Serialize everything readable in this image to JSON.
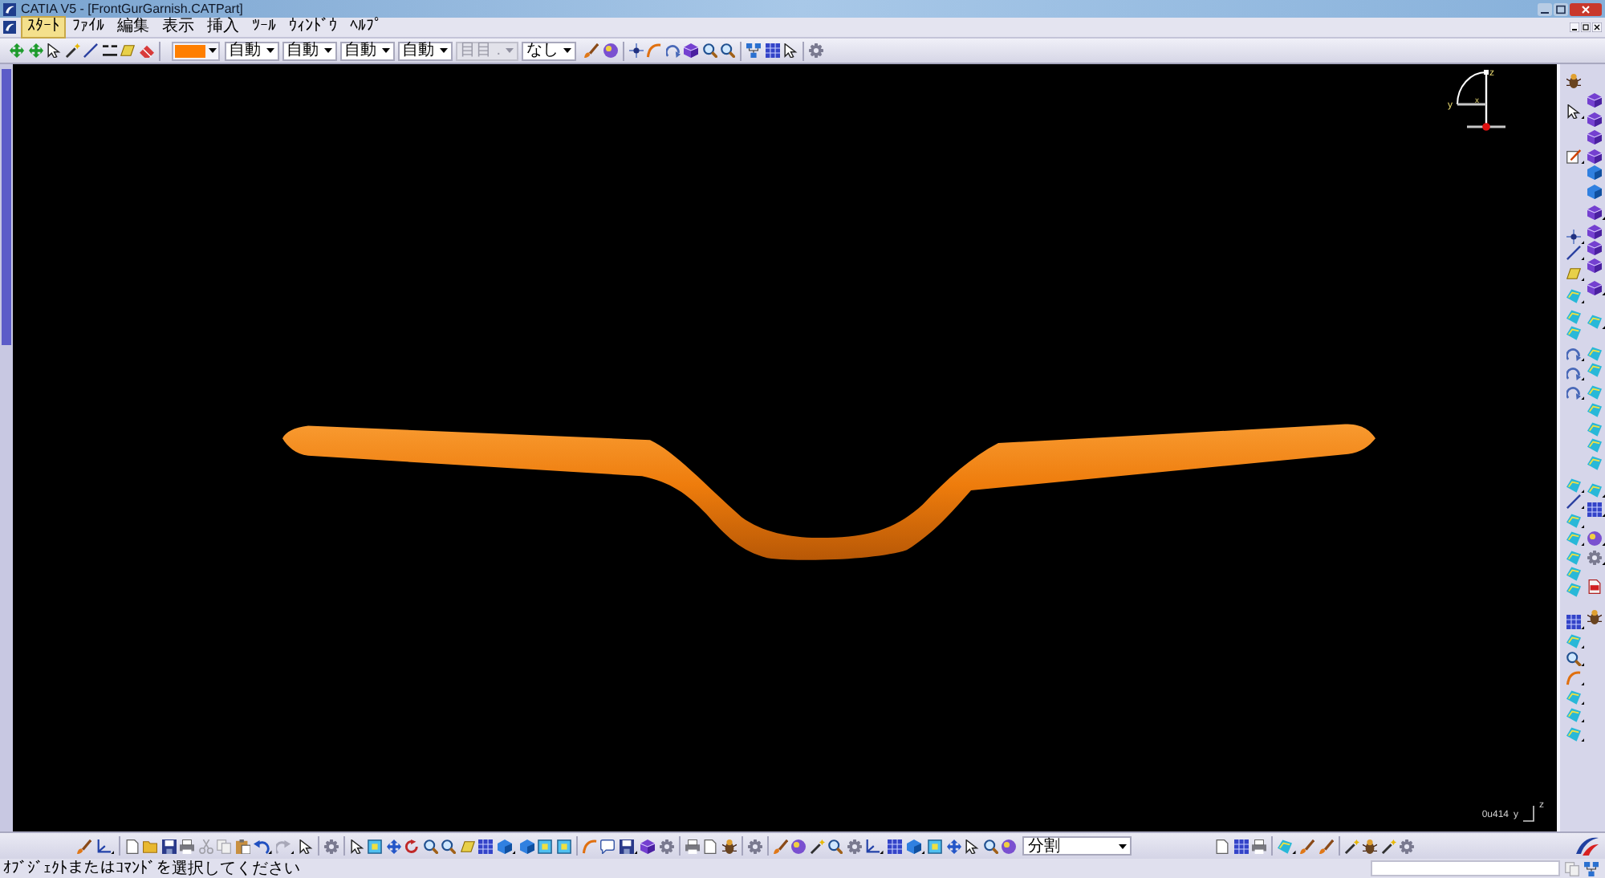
{
  "window": {
    "title": "CATIA V5 - [FrontGurGarnish.CATPart]"
  },
  "menu": [
    {
      "label": "ｽﾀｰﾄ",
      "selected": true
    },
    {
      "label": "ﾌｧｲﾙ",
      "selected": false
    },
    {
      "label": "編集",
      "selected": false
    },
    {
      "label": "表示",
      "selected": false
    },
    {
      "label": "挿入",
      "selected": false
    },
    {
      "label": "ﾂｰﾙ",
      "selected": false
    },
    {
      "label": "ｳｨﾝﾄﾞｳ",
      "selected": false
    },
    {
      "label": "ﾍﾙﾌﾟ",
      "selected": false
    }
  ],
  "graphic_properties": {
    "fill_color": {
      "color": "#ff7f00"
    },
    "dropdowns": [
      {
        "value": "自動",
        "disabled": false
      },
      {
        "value": "自動",
        "disabled": false
      },
      {
        "value": "自動",
        "disabled": false
      },
      {
        "value": "自動",
        "disabled": false
      },
      {
        "value": "目目 .",
        "disabled": true
      },
      {
        "value": "なし",
        "disabled": false
      }
    ]
  },
  "viewport": {
    "compass": {
      "labels": [
        "z",
        "y",
        "x"
      ]
    },
    "corner_axis": {
      "value": "0u414",
      "labels": [
        "y",
        "z"
      ]
    }
  },
  "bottom_toolbar": {
    "dropdown": {
      "value": "分割"
    }
  },
  "status_bar": {
    "message": "ｵﾌﾞｼﾞｪｸﾄまたはｺﾏﾝﾄﾞを選択してください"
  }
}
